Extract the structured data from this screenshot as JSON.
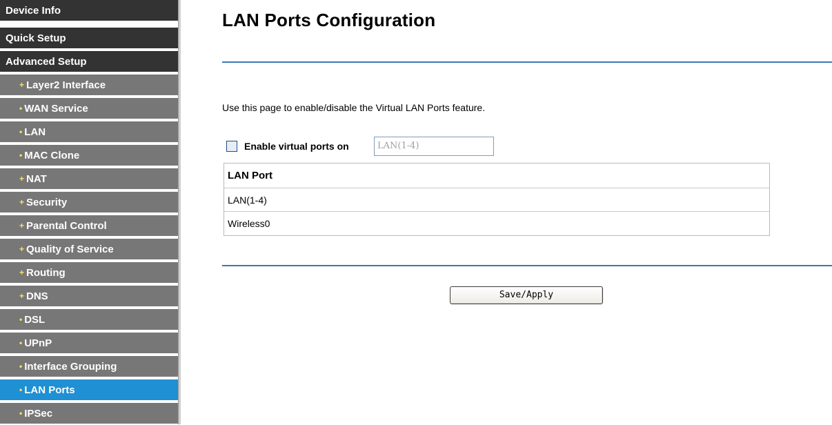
{
  "sidebar": {
    "top_items": [
      {
        "label": "Device Info"
      },
      {
        "label": "Quick Setup"
      },
      {
        "label": "Advanced Setup"
      }
    ],
    "sub_items": [
      {
        "label": "Layer2 Interface",
        "bullet": "+"
      },
      {
        "label": "WAN Service",
        "bullet": "•"
      },
      {
        "label": "LAN",
        "bullet": "•"
      },
      {
        "label": "MAC Clone",
        "bullet": "•"
      },
      {
        "label": "NAT",
        "bullet": "+"
      },
      {
        "label": "Security",
        "bullet": "+"
      },
      {
        "label": "Parental Control",
        "bullet": "+"
      },
      {
        "label": "Quality of Service",
        "bullet": "+"
      },
      {
        "label": "Routing",
        "bullet": "+"
      },
      {
        "label": "DNS",
        "bullet": "+"
      },
      {
        "label": "DSL",
        "bullet": "•"
      },
      {
        "label": "UPnP",
        "bullet": "•"
      },
      {
        "label": "Interface Grouping",
        "bullet": "•"
      },
      {
        "label": "LAN Ports",
        "bullet": "•",
        "active": true
      },
      {
        "label": "IPSec",
        "bullet": "•"
      }
    ]
  },
  "main": {
    "title": "LAN Ports Configuration",
    "description": "Use this page to enable/disable the Virtual LAN Ports feature.",
    "enable_label": "Enable virtual ports on",
    "enable_checked": false,
    "port_select_value": "LAN(1-4)",
    "table": {
      "header": "LAN Port",
      "rows": [
        "LAN(1-4)",
        "Wireless0"
      ]
    },
    "save_label": "Save/Apply"
  },
  "colors": {
    "nav_top_bg": "#333333",
    "nav_sub_bg": "#777777",
    "nav_active_bg": "#1e90d3",
    "divider": "#3a77b5"
  }
}
